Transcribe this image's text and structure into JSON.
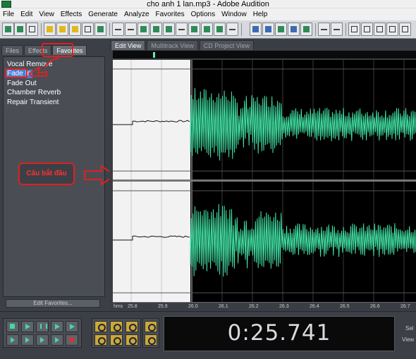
{
  "window": {
    "title": "cho anh 1 lan.mp3 - Adobe Audition"
  },
  "menu": [
    "File",
    "Edit",
    "View",
    "Effects",
    "Generate",
    "Analyze",
    "Favorites",
    "Options",
    "Window",
    "Help"
  ],
  "left_panel": {
    "tabs": [
      {
        "label": "Files",
        "active": false
      },
      {
        "label": "Effects",
        "active": false
      },
      {
        "label": "Favorites",
        "active": true
      }
    ],
    "favorites": [
      {
        "label": "Vocal Remove",
        "selected": false
      },
      {
        "label": "Fade In",
        "selected": true
      },
      {
        "label": "Fade Out",
        "selected": false
      },
      {
        "label": "Chamber Reverb",
        "selected": false
      },
      {
        "label": "Repair Transient",
        "selected": false
      }
    ],
    "edit_favorites_label": "Edit Favorites..."
  },
  "annotation": {
    "text": "Câu bắt đầu",
    "color": "#e02020"
  },
  "editor": {
    "view_tabs": [
      {
        "label": "Edit View",
        "active": true
      },
      {
        "label": "Multitrack View",
        "active": false
      },
      {
        "label": "CD Project View",
        "active": false
      }
    ],
    "waveform_color": "#43e6a8",
    "selection_color": "#f2f2f2",
    "ruler": {
      "unit": "hms",
      "ticks": [
        "25.8",
        "25.9",
        "26.0",
        "26.1",
        "26.2",
        "26.3",
        "26.4",
        "26.5",
        "26.6",
        "26.7"
      ]
    }
  },
  "transport": {
    "time": "0:25.741"
  },
  "selection_panel": {
    "labels": [
      "Sel",
      "View"
    ]
  }
}
